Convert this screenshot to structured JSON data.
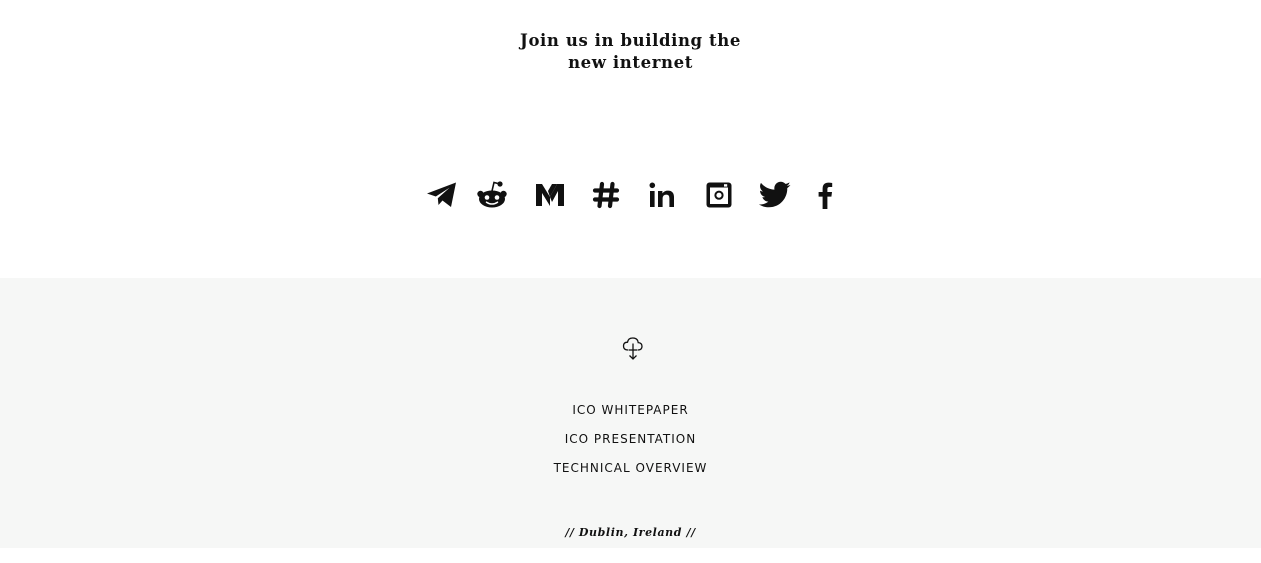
{
  "hero": {
    "heading_line1": "Join us in building the",
    "heading_line2": "new internet"
  },
  "social_links": [
    {
      "icon": "telegram-icon"
    },
    {
      "icon": "reddit-icon"
    },
    {
      "icon": "medium-icon"
    },
    {
      "icon": "slack-icon"
    },
    {
      "icon": "linkedin-icon"
    },
    {
      "icon": "instagram-icon"
    },
    {
      "icon": "twitter-icon"
    },
    {
      "icon": "facebook-icon"
    }
  ],
  "downloads": {
    "icon": "cloud-download-icon",
    "links": [
      {
        "label": "ICO WHITEPAPER"
      },
      {
        "label": "ICO PRESENTATION"
      },
      {
        "label": "TECHNICAL OVERVIEW"
      }
    ]
  },
  "footer": {
    "location": "// Dublin, Ireland //"
  },
  "colors": {
    "text": "#111111",
    "background": "#ffffff",
    "footer_background": "#f6f7f6"
  }
}
